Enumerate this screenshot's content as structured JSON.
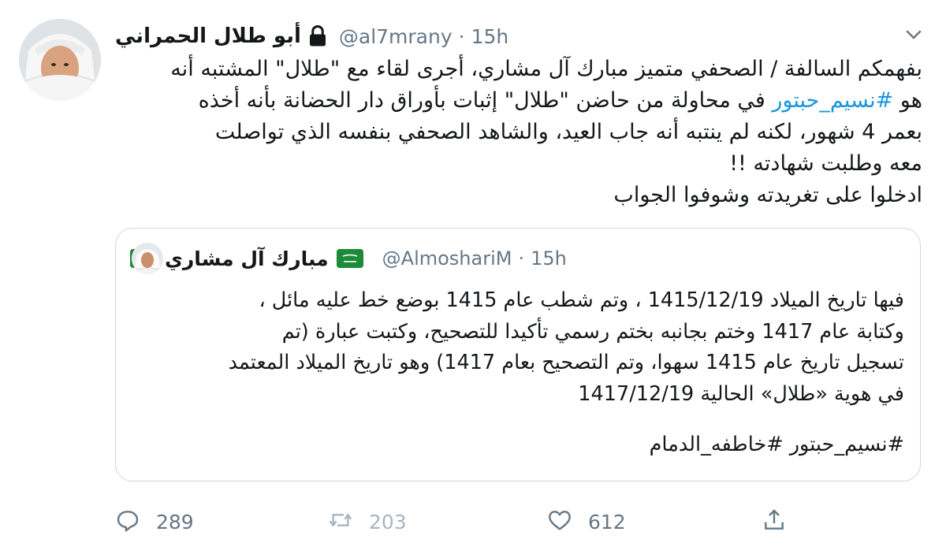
{
  "tweet": {
    "display_name": "أبو طلال الحمراني",
    "handle": "@al7mrany",
    "separator": "·",
    "time": "15h",
    "text_lines": [
      "بفهمكم السالفة / الصحفي متميز مبارك آل مشاري، أجرى لقاء مع \"طلال\" المشتبه أنه",
      "في محاولة من حاضن \"طلال\" إثبات بأوراق دار الحضانة بأنه أخذه",
      "بعمر 4 شهور، لكنه لم ينتبه أنه جاب العيد، والشاهد الصحفي بنفسه الذي تواصلت",
      "معه وطلبت شهادته !!",
      "ادخلوا على تغريدته وشوفوا الجواب"
    ],
    "line2_prefix": "هو ",
    "line2_hashtag": "#نسيم_حبتور",
    "icons": {
      "avatar": "profile-photo",
      "lock": "lock-icon",
      "menu": "chevron-down-icon"
    }
  },
  "quote": {
    "display_name": "مبارك آل مشاري",
    "handle": "@AlmoshariM",
    "separator": "·",
    "time": "15h",
    "text_lines": [
      "فيها تاريخ الميلاد 1415/12/19 ، وتم شطب عام  1415 بوضع خط عليه مائل ،",
      "وكتابة عام 1417 وختم بجانبه بختم رسمي تأكيدا للتصحيح، وكتبت عبارة (تم",
      "تسجيل تاريخ عام 1415 سهوا، وتم التصحيح بعام 1417) وهو تاريخ الميلاد المعتمد",
      "في هوية «طلال» الحالية 1417/12/19"
    ],
    "hashtags": "#نسيم_حبتور #خاطفه_الدمام",
    "icons": {
      "avatar": "profile-photo",
      "flag": "saudi-flag-icon"
    }
  },
  "actions": {
    "reply_count": "289",
    "retweet_count": "203",
    "like_count": "612",
    "icons": [
      "reply-icon",
      "retweet-icon",
      "like-icon",
      "share-icon"
    ]
  },
  "colors": {
    "text": "#14171a",
    "secondary": "#657786",
    "link": "#1b95e0",
    "border": "#ccd6dd",
    "flag_green": "#1d8a3a"
  }
}
